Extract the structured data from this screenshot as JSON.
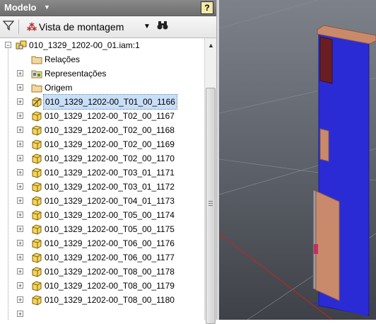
{
  "panel": {
    "title": "Modelo",
    "help_label": "?"
  },
  "toolbar": {
    "view_label": "Vista de montagem"
  },
  "tree": {
    "root": "010_1329_1202-00_01.iam:1",
    "folders": [
      "Relações",
      "Representações",
      "Origem"
    ],
    "parts": [
      "010_1329_1202-00_T01_00_1166",
      "010_1329_1202-00_T02_00_1167",
      "010_1329_1202-00_T02_00_1168",
      "010_1329_1202-00_T02_00_1169",
      "010_1329_1202-00_T02_00_1170",
      "010_1329_1202-00_T03_01_1171",
      "010_1329_1202-00_T03_01_1172",
      "010_1329_1202-00_T04_01_1173",
      "010_1329_1202-00_T05_00_1174",
      "010_1329_1202-00_T05_00_1175",
      "010_1329_1202-00_T06_00_1176",
      "010_1329_1202-00_T06_00_1177",
      "010_1329_1202-00_T08_00_1178",
      "010_1329_1202-00_T08_00_1179",
      "010_1329_1202-00_T08_00_1180"
    ],
    "selected_index": 0
  },
  "icons": {
    "folder": "folder-icon",
    "part": "part-icon",
    "assembly": "assembly-icon",
    "relations": "relations-icon",
    "representations": "representations-icon",
    "filter": "filter-icon",
    "binoculars": "binoculars-icon"
  },
  "colors": {
    "selection": "#c9dff7",
    "part_fill": "#f5d45a",
    "viewport_blue": "#2b2bd6",
    "viewport_brown": "#c98a6c"
  }
}
